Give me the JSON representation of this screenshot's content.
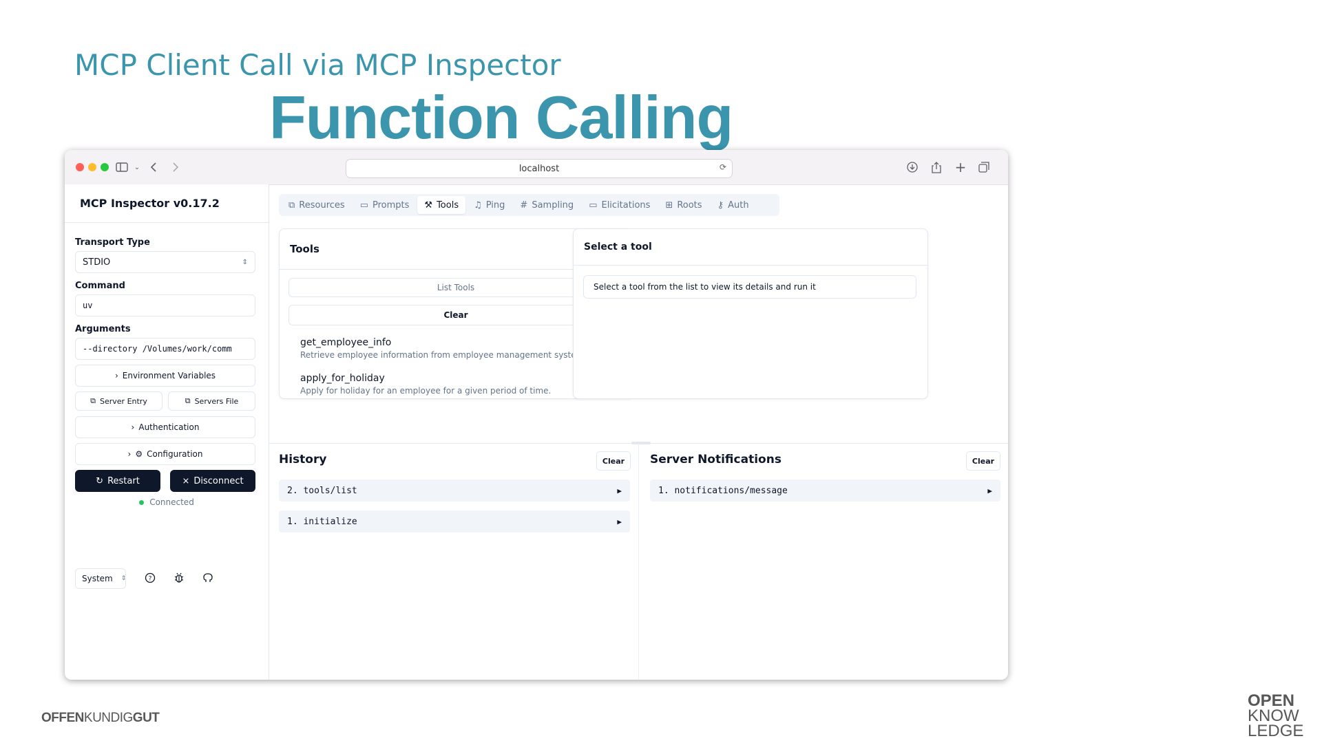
{
  "slide": {
    "title": "Function Calling",
    "subtitle": "MCP Client Call via MCP Inspector",
    "footer_left_bold1": "OFFEN",
    "footer_left_mid": "KUNDIG",
    "footer_left_bold2": "GUT",
    "footer_right": [
      "OPEN",
      "KNOW",
      "LEDGE"
    ]
  },
  "browser": {
    "url": "localhost"
  },
  "sidebar": {
    "title": "MCP Inspector v0.17.2",
    "transport_label": "Transport Type",
    "transport_value": "STDIO",
    "command_label": "Command",
    "command_value": "uv",
    "arguments_label": "Arguments",
    "arguments_value": "--directory /Volumes/work/comm",
    "env_vars": "Environment Variables",
    "server_entry": "Server Entry",
    "servers_file": "Servers File",
    "authentication": "Authentication",
    "configuration": "Configuration",
    "restart": "Restart",
    "disconnect": "Disconnect",
    "status": "Connected",
    "theme": "System"
  },
  "tabs": [
    "Resources",
    "Prompts",
    "Tools",
    "Ping",
    "Sampling",
    "Elicitations",
    "Roots",
    "Auth"
  ],
  "active_tab": "Tools",
  "tools_panel": {
    "title": "Tools",
    "list_tools": "List Tools",
    "clear": "Clear",
    "items": [
      {
        "name": "get_employee_info",
        "desc": "Retrieve employee information from employee management system."
      },
      {
        "name": "apply_for_holiday",
        "desc": "Apply for holiday for an employee for a given period of time."
      }
    ]
  },
  "detail_panel": {
    "title": "Select a tool",
    "hint": "Select a tool from the list to view its details and run it"
  },
  "history": {
    "title": "History",
    "clear": "Clear",
    "items": [
      "2. tools/list",
      "1. initialize"
    ]
  },
  "notifications": {
    "title": "Server Notifications",
    "clear": "Clear",
    "items": [
      "1. notifications/message"
    ]
  },
  "colors": {
    "brand": "#3a95ad",
    "dark_button": "#0f172a",
    "status_dot": "#22c55e"
  }
}
